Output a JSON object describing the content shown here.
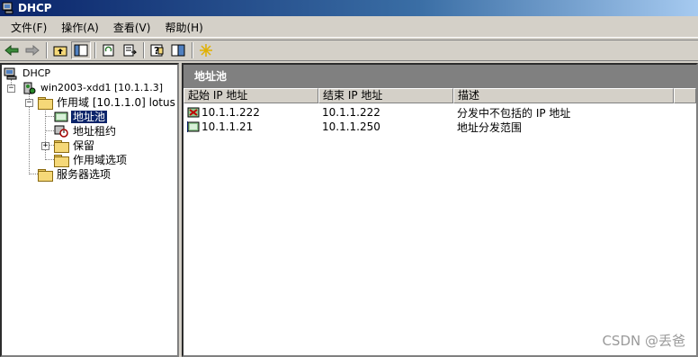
{
  "window": {
    "title": "DHCP",
    "icon": "dhcp-console-icon"
  },
  "menu": [
    {
      "label": "文件(F)"
    },
    {
      "label": "操作(A)"
    },
    {
      "label": "查看(V)"
    },
    {
      "label": "帮助(H)"
    }
  ],
  "toolbar": {
    "buttons": [
      "back-arrow-icon",
      "forward-arrow-icon",
      "up-folder-icon",
      "show-tree-icon",
      "refresh-icon",
      "export-list-icon",
      "help-icon",
      "properties-icon",
      "new-scope-icon"
    ]
  },
  "tree": {
    "root": "DHCP",
    "server": "win2003-xdd1 [10.1.1.3]",
    "scope": "作用域 [10.1.1.0] lotus",
    "address_pool": "地址池",
    "leases": "地址租约",
    "reservations": "保留",
    "scope_options": "作用域选项",
    "server_options": "服务器选项"
  },
  "detail": {
    "header": "地址池",
    "columns": [
      "起始 IP 地址",
      "结束 IP 地址",
      "描述"
    ],
    "rows": [
      {
        "start": "10.1.1.222",
        "end": "10.1.1.222",
        "desc": "分发中不包括的 IP 地址",
        "icon": "exclusion-range-icon"
      },
      {
        "start": "10.1.1.21",
        "end": "10.1.1.250",
        "desc": "地址分发范围",
        "icon": "address-range-icon"
      }
    ]
  },
  "watermark": "CSDN @丢爸",
  "colors": {
    "title_bar": "#0a246a",
    "selection": "#0a246a",
    "pane_header": "#808080",
    "chrome": "#d4d0c8"
  }
}
